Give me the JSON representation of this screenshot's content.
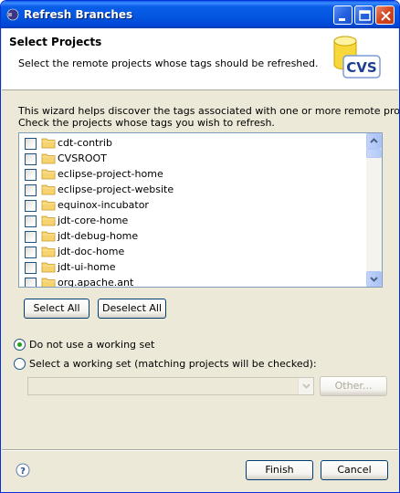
{
  "window": {
    "title": "Refresh Branches"
  },
  "header": {
    "title": "Select Projects",
    "description": "Select the remote projects whose tags should be refreshed.",
    "logo_text": "CVS"
  },
  "intro": {
    "line1": "This wizard helps discover the tags associated with one or more remote projects.",
    "line2": "Check the projects whose tags you wish to refresh."
  },
  "projects": [
    {
      "label": "cdt-contrib",
      "checked": false
    },
    {
      "label": "CVSROOT",
      "checked": false
    },
    {
      "label": "eclipse-project-home",
      "checked": false
    },
    {
      "label": "eclipse-project-website",
      "checked": false
    },
    {
      "label": "equinox-incubator",
      "checked": false
    },
    {
      "label": "jdt-core-home",
      "checked": false
    },
    {
      "label": "jdt-debug-home",
      "checked": false
    },
    {
      "label": "jdt-doc-home",
      "checked": false
    },
    {
      "label": "jdt-ui-home",
      "checked": false
    },
    {
      "label": "org.apache.ant",
      "checked": false
    }
  ],
  "buttons": {
    "select_all": "Select All",
    "deselect_all": "Deselect All",
    "other": "Other...",
    "finish": "Finish",
    "cancel": "Cancel"
  },
  "working_set": {
    "option_none": "Do not use a working set",
    "option_select": "Select a working set (matching projects will be checked):",
    "selected": "none",
    "combo_value": ""
  },
  "colors": {
    "titlebar": "#0a5ee8",
    "dialog_bg": "#ece9d8",
    "folder": "#f1c25b"
  }
}
